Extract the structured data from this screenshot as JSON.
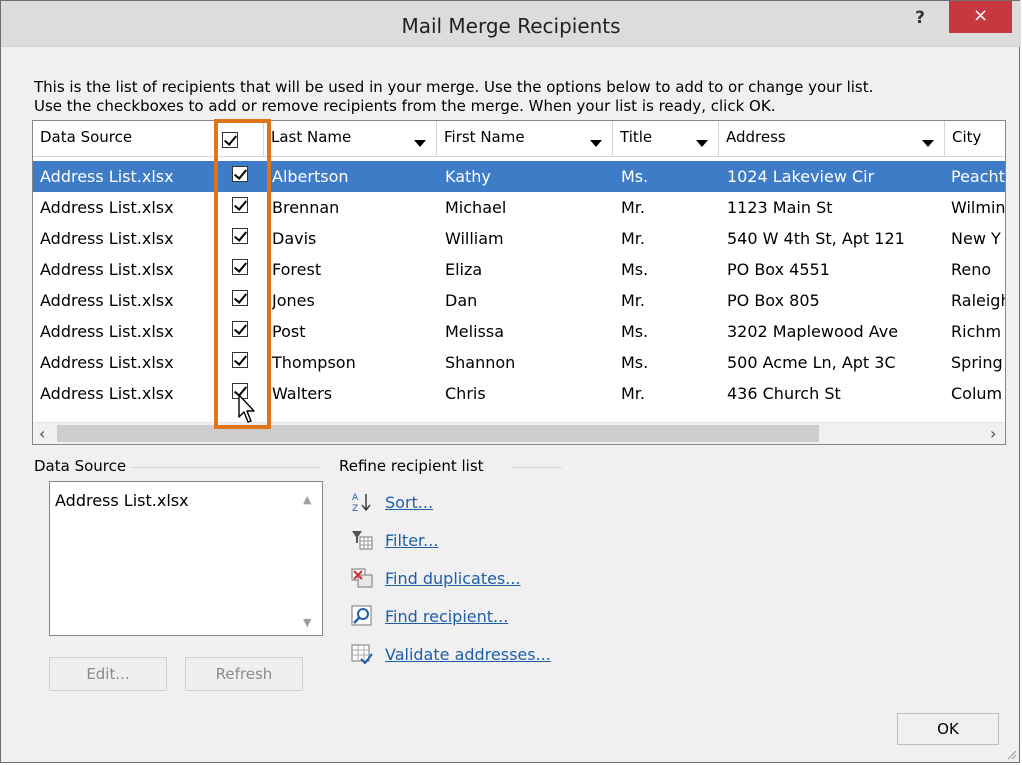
{
  "dialog": {
    "title": "Mail Merge Recipients",
    "help": "?",
    "close": "×"
  },
  "intro": {
    "line1": "This is the list of recipients that will be used in your merge.  Use the options below to add to or change your list.",
    "line2": "Use the checkboxes to add or remove recipients from the merge.  When your list is ready, click OK."
  },
  "columns": [
    "Data Source",
    "",
    "Last Name",
    "First Name",
    "Title",
    "Address",
    "City"
  ],
  "rows": [
    {
      "source": "Address List.xlsx",
      "checked": true,
      "last": "Albertson",
      "first": "Kathy",
      "title": "Ms.",
      "address": "1024 Lakeview Cir",
      "city": "Peacht",
      "selected": true
    },
    {
      "source": "Address List.xlsx",
      "checked": true,
      "last": "Brennan",
      "first": "Michael",
      "title": "Mr.",
      "address": "1123 Main St",
      "city": "Wilmin"
    },
    {
      "source": "Address List.xlsx",
      "checked": true,
      "last": "Davis",
      "first": "William",
      "title": "Mr.",
      "address": "540 W 4th St, Apt 121",
      "city": "New Y"
    },
    {
      "source": "Address List.xlsx",
      "checked": true,
      "last": "Forest",
      "first": "Eliza",
      "title": "Ms.",
      "address": "PO Box 4551",
      "city": "Reno"
    },
    {
      "source": "Address List.xlsx",
      "checked": true,
      "last": "Jones",
      "first": "Dan",
      "title": "Mr.",
      "address": "PO Box 805",
      "city": "Raleigh"
    },
    {
      "source": "Address List.xlsx",
      "checked": true,
      "last": "Post",
      "first": "Melissa",
      "title": "Ms.",
      "address": "3202 Maplewood Ave",
      "city": "Richm"
    },
    {
      "source": "Address List.xlsx",
      "checked": true,
      "last": "Thompson",
      "first": "Shannon",
      "title": "Ms.",
      "address": "500 Acme Ln, Apt 3C",
      "city": "Spring"
    },
    {
      "source": "Address List.xlsx",
      "checked": true,
      "last": "Walters",
      "first": "Chris",
      "title": "Mr.",
      "address": "436 Church St",
      "city": "Colum"
    }
  ],
  "data_source": {
    "label": "Data Source",
    "items": [
      "Address List.xlsx"
    ],
    "edit_label": "Edit...",
    "refresh_label": "Refresh"
  },
  "refine": {
    "label": "Refine recipient list",
    "links": [
      {
        "label": "Sort...",
        "icon": "sort-az-icon"
      },
      {
        "label": "Filter...",
        "icon": "filter-icon"
      },
      {
        "label": "Find duplicates...",
        "icon": "find-duplicates-icon"
      },
      {
        "label": "Find recipient...",
        "icon": "find-recipient-icon"
      },
      {
        "label": "Validate addresses...",
        "icon": "validate-addresses-icon"
      }
    ]
  },
  "ok_label": "OK",
  "colors": {
    "highlight": "#e0741a",
    "selection": "#3e7cc8",
    "close": "#c8373f",
    "link": "#1f5faa"
  }
}
